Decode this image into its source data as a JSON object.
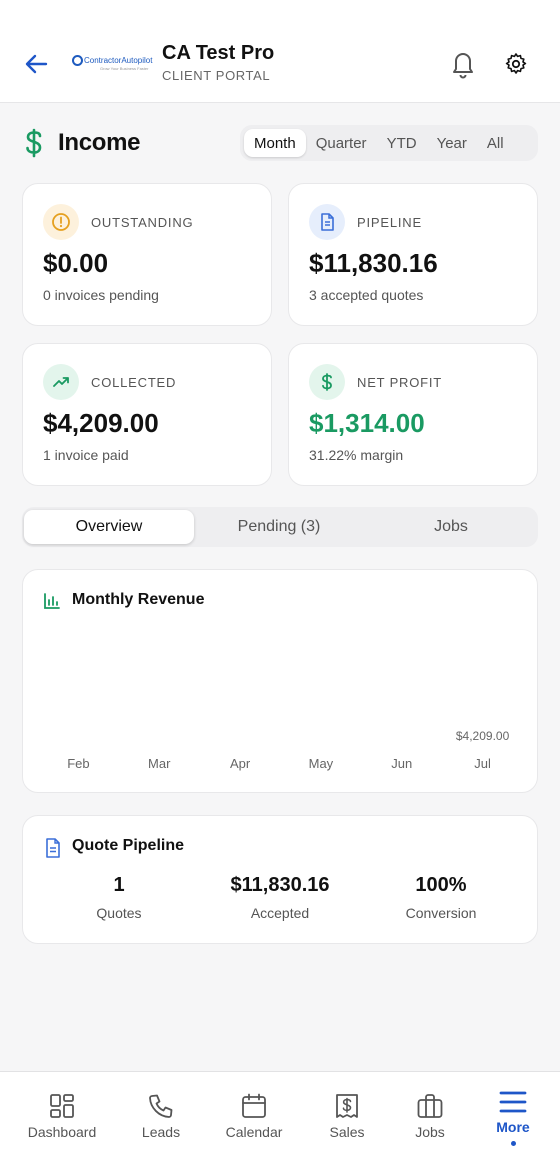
{
  "header": {
    "title": "CA Test Pro",
    "subtitle": "CLIENT PORTAL",
    "logo_text": "ContractorAutopilot",
    "logo_sub": "Grow Your Business Faster"
  },
  "income": {
    "title": "Income",
    "periods": [
      "Month",
      "Quarter",
      "YTD",
      "Year",
      "All"
    ],
    "active_period": "Month"
  },
  "stats": {
    "outstanding": {
      "label": "OUTSTANDING",
      "value": "$0.00",
      "sub": "0 invoices pending",
      "icon": "alert-circle-icon",
      "color": "#e5a01f"
    },
    "pipeline": {
      "label": "PIPELINE",
      "value": "$11,830.16",
      "sub": "3 accepted quotes",
      "icon": "document-icon",
      "color": "#3b6fd8"
    },
    "collected": {
      "label": "COLLECTED",
      "value": "$4,209.00",
      "sub": "1 invoice paid",
      "icon": "trending-up-icon",
      "color": "#1a9a62"
    },
    "net_profit": {
      "label": "NET PROFIT",
      "value": "$1,314.00",
      "sub": "31.22% margin",
      "icon": "dollar-icon",
      "color": "#1a9a62"
    }
  },
  "tabs": [
    "Overview",
    "Pending (3)",
    "Jobs"
  ],
  "monthly_revenue": {
    "title": "Monthly Revenue",
    "months": [
      "Feb",
      "Mar",
      "Apr",
      "May",
      "Jun",
      "Jul"
    ],
    "jul_label": "$4,209.00"
  },
  "chart_data": {
    "type": "bar",
    "title": "Monthly Revenue",
    "categories": [
      "Feb",
      "Mar",
      "Apr",
      "May",
      "Jun",
      "Jul"
    ],
    "values": [
      0,
      0,
      0,
      0,
      0,
      4209.0
    ],
    "data_labels": [
      "",
      "",
      "",
      "",
      "",
      "$4,209.00"
    ]
  },
  "quote_pipeline": {
    "title": "Quote Pipeline",
    "items": [
      {
        "value": "1",
        "label": "Quotes"
      },
      {
        "value": "$11,830.16",
        "label": "Accepted"
      },
      {
        "value": "100%",
        "label": "Conversion"
      }
    ]
  },
  "nav": {
    "items": [
      {
        "label": "Dashboard",
        "icon": "dashboard-icon"
      },
      {
        "label": "Leads",
        "icon": "phone-icon"
      },
      {
        "label": "Calendar",
        "icon": "calendar-icon"
      },
      {
        "label": "Sales",
        "icon": "receipt-icon"
      },
      {
        "label": "Jobs",
        "icon": "briefcase-icon"
      },
      {
        "label": "More",
        "icon": "menu-icon"
      }
    ],
    "active": "More"
  },
  "colors": {
    "accent_blue": "#1e56c8",
    "green": "#1a9a62"
  }
}
